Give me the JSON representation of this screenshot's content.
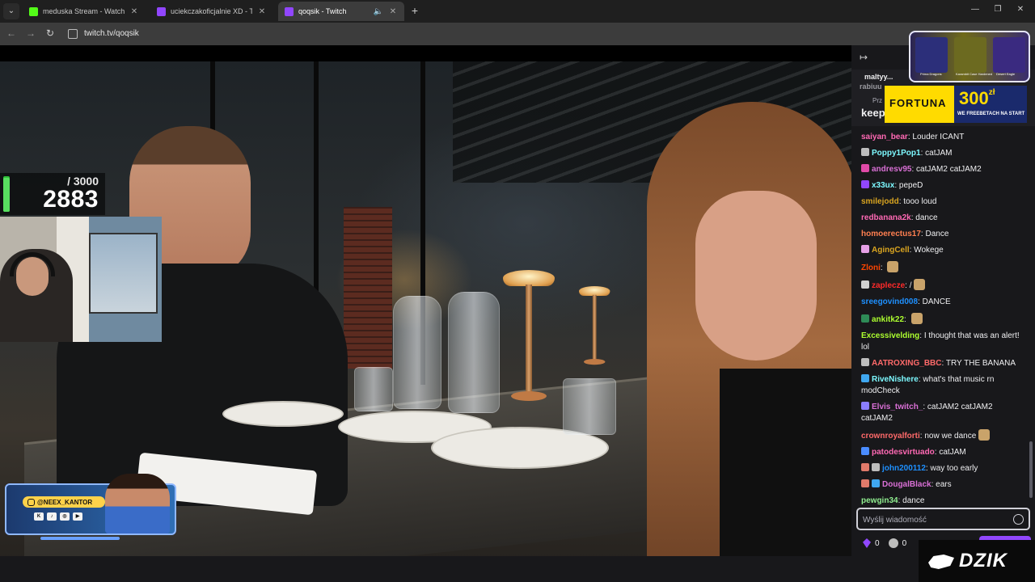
{
  "browser": {
    "tabs": [
      {
        "title": "meduska Stream - Watch Live o",
        "favicon_color": "#53fc18"
      },
      {
        "title": "uciekczakoficjalnie XD - Twitch",
        "favicon_color": "#9146ff"
      },
      {
        "title": "qoqsik - Twitch",
        "favicon_color": "#9146ff",
        "active": true
      }
    ],
    "url": "twitch.tv/qoqsik"
  },
  "stream_overlay": {
    "counter_max": "/ 3000",
    "counter_current": "2883",
    "counter_progress": 0.961,
    "promo_handle": "@NEEX_KANTOR",
    "promo_socials": [
      "K",
      "tiktok",
      "ig",
      "yt"
    ]
  },
  "ads": {
    "fortuna_brand": "FORTUNA",
    "fortuna_amount": "300",
    "fortuna_currency": "zł",
    "fortuna_sub": "WE FREEBETACH NA START",
    "dzik_brand": "DZIK",
    "top_ad_labels": [
      "Prima Dragons",
      "Karambit Case Hardened",
      "Desert Eagle"
    ]
  },
  "chat": {
    "pinned": {
      "user": "maltyy...",
      "user2": "rabiuu",
      "meta": "Prz",
      "text": "keep"
    },
    "input_placeholder": "Wyślij wiadomość",
    "bits_count": "0",
    "points_count": "0",
    "messages": [
      {
        "user": "saiyan_bear",
        "color": "#ff69b4",
        "text": "Louder ICANT",
        "badges": []
      },
      {
        "user": "Poppy1Pop1",
        "color": "#7df9ff",
        "text": "catJAM",
        "badges": [
          "#bdbdbd"
        ]
      },
      {
        "user": "andresv95",
        "color": "#da70d6",
        "text": "catJAM2 catJAM2",
        "badges": [
          "#e04aa8"
        ]
      },
      {
        "user": "x33ux",
        "color": "#7df9ff",
        "text": "pepeD",
        "badges": [
          "#9147ff"
        ]
      },
      {
        "user": "smilejodd",
        "color": "#daa520",
        "text": "tooo loud",
        "badges": []
      },
      {
        "user": "redbanana2k",
        "color": "#ff69b4",
        "text": "dance",
        "badges": []
      },
      {
        "user": "homoerectus17",
        "color": "#ff7f50",
        "text": "Dance",
        "badges": []
      },
      {
        "user": "AgingCell",
        "color": "#daa520",
        "text": "Wokege",
        "badges": [
          "#e6a0e6"
        ]
      },
      {
        "user": "Zloni",
        "color": "#ff4500",
        "text": "",
        "badges": [],
        "emote": true
      },
      {
        "user": "zaplecze",
        "color": "#ff2a2a",
        "text": "/",
        "badges": [
          "#d0d0d0"
        ],
        "emote": true
      },
      {
        "user": "sreegovind008",
        "color": "#1e90ff",
        "text": "DANCE",
        "badges": []
      },
      {
        "user": "ankitk22",
        "color": "#adff2f",
        "text": "",
        "badges": [
          "#2e8b57"
        ],
        "emote": true
      },
      {
        "user": "Excessivelding",
        "color": "#adff2f",
        "text": "I thought that was an alert! lol",
        "badges": []
      },
      {
        "user": "AATROXING_BBC",
        "color": "#ff6a6a",
        "text": "TRY THE BANANA",
        "badges": [
          "#bdbdbd"
        ]
      },
      {
        "user": "RiveNishere",
        "color": "#7df9ff",
        "text": "what's that music rn modCheck",
        "badges": [
          "#3fa7f0"
        ]
      },
      {
        "user": "Elvis_twitch_",
        "color": "#da70d6",
        "text": "catJAM2 catJAM2 catJAM2",
        "badges": [
          "#8a7dff"
        ]
      },
      {
        "user": "crownroyalforti",
        "color": "#ff6a6a",
        "text": "now we dance",
        "badges": [],
        "emote": true
      },
      {
        "user": "patodesvirtuado",
        "color": "#ff69b4",
        "text": "catJAM",
        "badges": [
          "#4a8cff"
        ]
      },
      {
        "user": "john200112",
        "color": "#1e90ff",
        "text": "way too early",
        "badges": [
          "#e07a6a",
          "#bdbdbd"
        ]
      },
      {
        "user": "DougalBlack",
        "color": "#da70d6",
        "text": "ears",
        "badges": [
          "#e07a6a",
          "#3fa7f0"
        ]
      },
      {
        "user": "pewgin34",
        "color": "#90ee90",
        "text": "dance",
        "badges": []
      }
    ]
  }
}
